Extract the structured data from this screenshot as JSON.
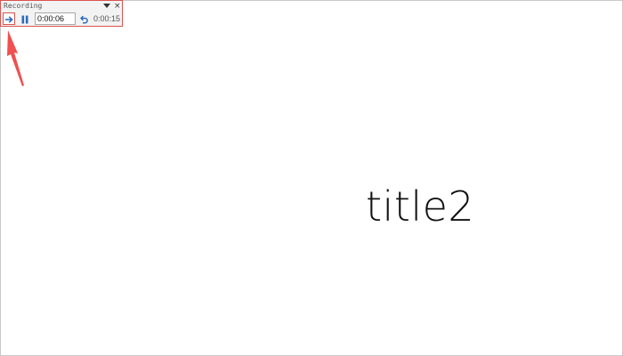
{
  "recording_toolbar": {
    "title": "Recording",
    "dropdown_icon": "chevron-down-icon",
    "close_label": "×",
    "next_icon": "arrow-right-icon",
    "pause_icon": "pause-icon",
    "current_time": "0:00:06",
    "repeat_icon": "undo-icon",
    "total_time": "0:00:15"
  },
  "slide": {
    "title": "title2"
  },
  "colors": {
    "toolbar_border": "#d9534f",
    "icon_blue": "#2a6ebb",
    "annotation_red": "#f05050"
  }
}
